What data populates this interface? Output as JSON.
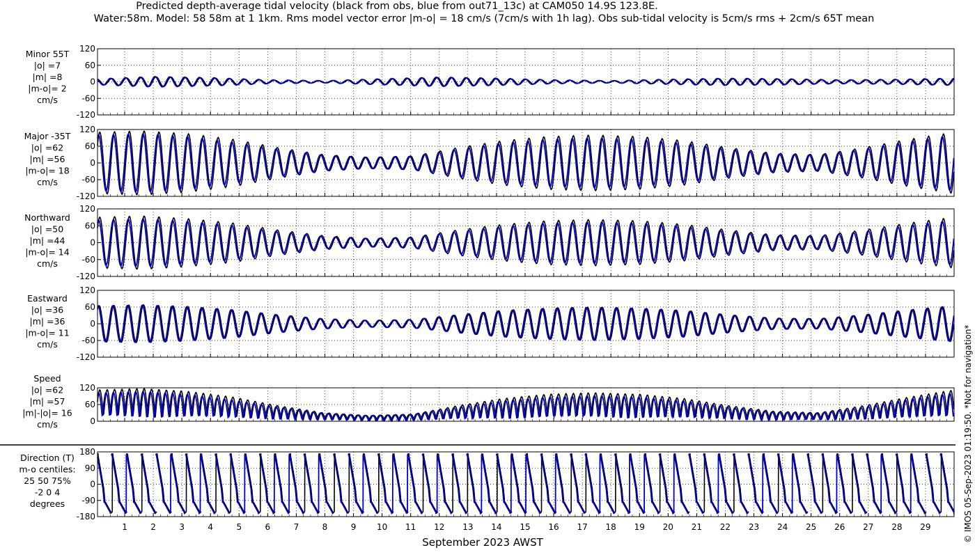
{
  "title_line1": "Predicted depth-average tidal velocity (black from obs, blue from out71_13c) at CAM050 14.9S 123.8E.",
  "title_line2": "Water:58m. Model: 58 58m at 1 1km. Rms model vector error |m-o| = 18 cm/s (7cm/s with 1h lag). Obs sub-tidal velocity is 5cm/s rms + 2cm/s 65T mean",
  "footnote": "© IMOS 05-Sep-2023 01:19:50. *Not for navigation*",
  "colors": {
    "obs": "#000000",
    "model": "#0000cc",
    "axes": "#000000",
    "grid": "#000000"
  },
  "chart_data": {
    "type": "line",
    "xlabel": "September 2023 AWST",
    "x_ticks": [
      "1",
      "2",
      "3",
      "4",
      "5",
      "6",
      "7",
      "8",
      "9",
      "10",
      "11",
      "12",
      "13",
      "14",
      "15",
      "16",
      "17",
      "18",
      "19",
      "20",
      "21",
      "22",
      "23",
      "24",
      "25",
      "26",
      "27",
      "28",
      "29"
    ],
    "xlim": [
      0.05,
      30.0
    ],
    "series_legend": [
      {
        "name": "obs",
        "color": "#000000"
      },
      {
        "name": "out71_13c",
        "color": "#0000cc"
      }
    ],
    "panels": [
      {
        "label": [
          "Minor 55T",
          "|o| =7",
          "|m| =8",
          "|m-o|= 2",
          "cm/s"
        ],
        "ylim": [
          -120,
          120
        ],
        "yticks": [
          "120",
          "60",
          "0",
          "-60",
          "-120"
        ],
        "ytick_values": [
          120,
          60,
          0,
          -60,
          -120
        ],
        "kind": "minor",
        "amplitude_envelope_obs": [
          10,
          18,
          14,
          6,
          4,
          10,
          16,
          12,
          6,
          4,
          8,
          12,
          10,
          6,
          8,
          12
        ],
        "amplitude_envelope_model": [
          11,
          19,
          15,
          7,
          4,
          11,
          17,
          13,
          7,
          4,
          9,
          13,
          11,
          7,
          9,
          13
        ]
      },
      {
        "label": [
          "Major -35T",
          "|o| =62",
          "|m| =56",
          "|m-o|= 18",
          "cm/s"
        ],
        "ylim": [
          -120,
          120
        ],
        "yticks": [
          "120",
          "60",
          "0",
          "-60",
          "-120"
        ],
        "ytick_values": [
          120,
          60,
          0,
          -60,
          -120
        ],
        "kind": "major",
        "amplitude_envelope_obs": [
          110,
          115,
          105,
          85,
          55,
          30,
          20,
          25,
          55,
          80,
          95,
          100,
          95,
          80,
          55,
          35,
          30,
          55,
          85,
          110
        ],
        "amplitude_envelope_model": [
          100,
          105,
          95,
          75,
          50,
          28,
          20,
          24,
          50,
          72,
          85,
          90,
          85,
          72,
          50,
          32,
          28,
          50,
          78,
          100
        ]
      },
      {
        "label": [
          "Northward",
          "|o| =50",
          "|m| =44",
          "|m-o|= 14",
          "cm/s"
        ],
        "ylim": [
          -120,
          120
        ],
        "yticks": [
          "120",
          "60",
          "0",
          "-60",
          "-120"
        ],
        "ytick_values": [
          120,
          60,
          0,
          -60,
          -120
        ],
        "kind": "north",
        "amplitude_envelope_obs": [
          90,
          95,
          85,
          70,
          45,
          25,
          15,
          20,
          45,
          65,
          78,
          82,
          78,
          65,
          45,
          28,
          25,
          45,
          70,
          90
        ],
        "amplitude_envelope_model": [
          80,
          85,
          76,
          62,
          40,
          22,
          15,
          18,
          40,
          58,
          70,
          74,
          70,
          58,
          40,
          25,
          22,
          40,
          62,
          80
        ]
      },
      {
        "label": [
          "Eastward",
          "|o| =36",
          "|m| =36",
          "|m-o|= 11",
          "cm/s"
        ],
        "ylim": [
          -120,
          120
        ],
        "yticks": [
          "120",
          "60",
          "0",
          "-60",
          "-120"
        ],
        "ytick_values": [
          120,
          60,
          0,
          -60,
          -120
        ],
        "kind": "east",
        "amplitude_envelope_obs": [
          65,
          68,
          62,
          50,
          32,
          18,
          12,
          15,
          32,
          48,
          56,
          60,
          56,
          48,
          32,
          20,
          18,
          32,
          50,
          65
        ],
        "amplitude_envelope_model": [
          64,
          67,
          61,
          50,
          32,
          18,
          12,
          15,
          32,
          47,
          55,
          59,
          55,
          47,
          32,
          20,
          18,
          32,
          49,
          64
        ]
      },
      {
        "label": [
          "Speed",
          "|o| =62",
          "|m| =57",
          "|m|-|o|= 16",
          "cm/s"
        ],
        "ylim": [
          0,
          120
        ],
        "yticks": [
          "120",
          "60",
          "0"
        ],
        "ytick_values": [
          120,
          60,
          0
        ],
        "kind": "speed",
        "amplitude_envelope_obs": [
          110,
          115,
          105,
          85,
          55,
          30,
          20,
          25,
          55,
          80,
          95,
          100,
          95,
          80,
          55,
          35,
          30,
          55,
          85,
          110
        ],
        "amplitude_envelope_model": [
          100,
          105,
          95,
          75,
          50,
          28,
          20,
          24,
          50,
          72,
          85,
          90,
          85,
          72,
          50,
          32,
          28,
          50,
          78,
          100
        ]
      },
      {
        "label": [
          "Direction (T)",
          "m-o centiles:",
          "25  50  75%",
          "-2  0  4",
          "degrees"
        ],
        "ylim": [
          -180,
          180
        ],
        "yticks": [
          "180",
          "90",
          "0",
          "-90",
          "-180"
        ],
        "ytick_values": [
          180,
          90,
          0,
          -90,
          -180
        ],
        "kind": "direction"
      }
    ]
  }
}
